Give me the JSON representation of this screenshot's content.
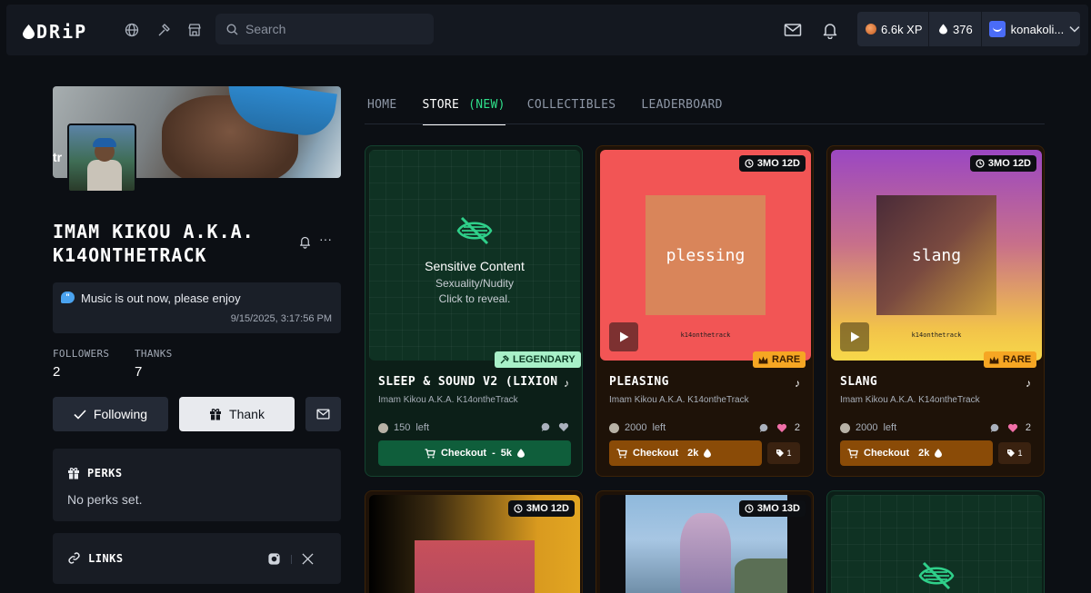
{
  "header": {
    "logo": "DRiP",
    "search_placeholder": "Search",
    "xp": "6.6k XP",
    "drip_balance": "376",
    "username": "konakoli..."
  },
  "profile": {
    "name": "IMAM KIKOU A.K.A. K14ONTHETRACK",
    "banner_text": "tr",
    "message": "Music is out now, please enjoy",
    "message_time": "9/15/2025, 3:17:56 PM",
    "followers_label": "FOLLOWERS",
    "followers": "2",
    "thanks_label": "THANKS",
    "thanks": "7",
    "following_button": "Following",
    "thank_button": "Thank",
    "perks_title": "PERKS",
    "perks_body": "No perks set.",
    "links_title": "LINKS"
  },
  "tabs": [
    {
      "label": "HOME"
    },
    {
      "label": "STORE",
      "badge": "(NEW)"
    },
    {
      "label": "COLLECTIBLES"
    },
    {
      "label": "LEADERBOARD"
    }
  ],
  "cards": [
    {
      "title": "SLEEP & SOUND V2 (LIXION ...",
      "artist": "Imam Kikou A.K.A. K14ontheTrack",
      "left": "150",
      "left_label": "left",
      "rarity": "LEGENDARY",
      "checkout": "Checkout",
      "price": "5k",
      "sensitive_title": "Sensitive Content",
      "sensitive_reason": "Sexuality/Nudity",
      "sensitive_hint": "Click to reveal."
    },
    {
      "title": "PLEASING",
      "artist": "Imam Kikou A.K.A. K14ontheTrack",
      "left": "2000",
      "left_label": "left",
      "likes": "2",
      "rarity": "RARE",
      "time": "3MO 12D",
      "checkout": "Checkout",
      "price": "2k",
      "cover_text": "plessing",
      "cover_sub": "k14onthetrack",
      "cover_color": "#d9855a",
      "bg_color": "#f25555",
      "tag": "1"
    },
    {
      "title": "SLANG",
      "artist": "Imam Kikou A.K.A. K14ontheTrack",
      "left": "2000",
      "left_label": "left",
      "likes": "2",
      "rarity": "RARE",
      "time": "3MO 12D",
      "checkout": "Checkout",
      "price": "2k",
      "cover_text": "slang",
      "cover_sub": "k14onthetrack",
      "tag": "1"
    },
    {
      "time": "3MO 12D"
    },
    {
      "time": "3MO 13D"
    },
    {}
  ]
}
